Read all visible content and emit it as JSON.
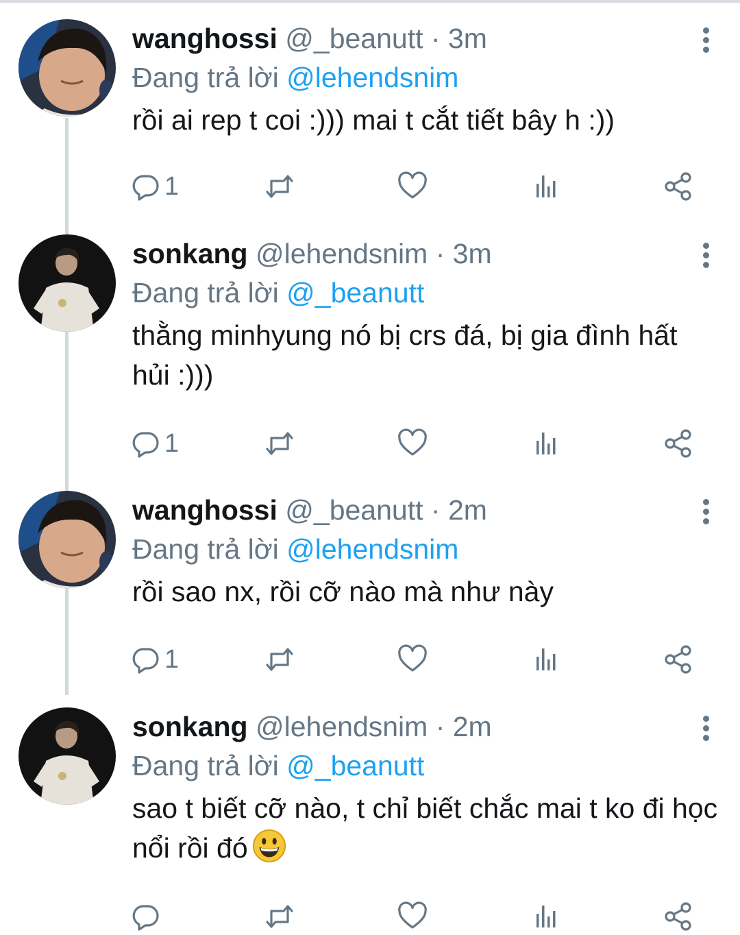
{
  "tweets": [
    {
      "display_name": "wanghossi",
      "handle": "@_beanutt",
      "sep": " · ",
      "time": "3m",
      "reply_prefix": "Đang trả lời ",
      "reply_to": "@lehendsnim",
      "text": "rồi ai rep t coi :))) mai t cắt tiết bây h :))",
      "reply_count": "1"
    },
    {
      "display_name": "sonkang",
      "handle": "@lehendsnim",
      "sep": " · ",
      "time": "3m",
      "reply_prefix": "Đang trả lời ",
      "reply_to": "@_beanutt",
      "text": "thằng minhyung nó bị crs đá, bị gia đình hất hủi :)))",
      "reply_count": "1"
    },
    {
      "display_name": "wanghossi",
      "handle": "@_beanutt",
      "sep": " · ",
      "time": "2m",
      "reply_prefix": "Đang trả lời ",
      "reply_to": "@lehendsnim",
      "text": "rồi sao nx, rồi cỡ nào mà như này",
      "reply_count": "1"
    },
    {
      "display_name": "sonkang",
      "handle": "@lehendsnim",
      "sep": " · ",
      "time": "2m",
      "reply_prefix": "Đang trả lời ",
      "reply_to": "@_beanutt",
      "text": "sao t biết cỡ nào, t chỉ biết chắc mai t ko đi học nổi rồi đó",
      "reply_count": ""
    }
  ],
  "icons": {
    "reply": "reply-icon",
    "retweet": "retweet-icon",
    "like": "heart-icon",
    "analytics": "analytics-icon",
    "share": "share-icon",
    "more": "more-vertical-icon",
    "emoji": "grinning-face-emoji"
  },
  "colors": {
    "accent": "#1da1f2",
    "secondary_text": "#657786",
    "thread_line": "#cfd9de"
  }
}
